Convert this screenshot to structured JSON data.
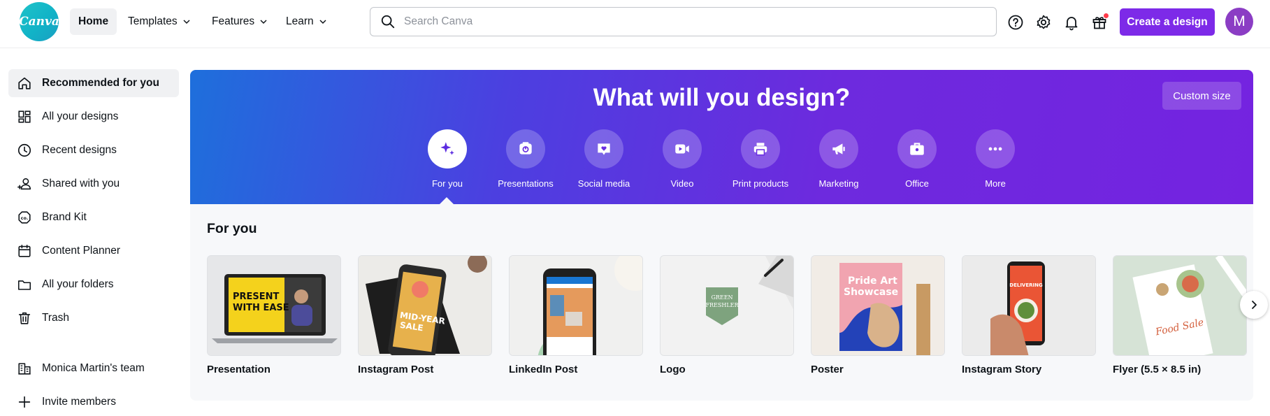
{
  "app": {
    "logo_text": "Canva"
  },
  "topnav": {
    "items": [
      {
        "label": "Home"
      },
      {
        "label": "Templates"
      },
      {
        "label": "Features"
      },
      {
        "label": "Learn"
      }
    ],
    "search_placeholder": "Search Canva",
    "create_label": "Create a design",
    "avatar_initial": "M"
  },
  "sidebar": {
    "items": [
      {
        "label": "Recommended for you",
        "icon": "home-icon"
      },
      {
        "label": "All your designs",
        "icon": "grid-icon"
      },
      {
        "label": "Recent designs",
        "icon": "clock-icon"
      },
      {
        "label": "Shared with you",
        "icon": "people-icon"
      },
      {
        "label": "Brand Kit",
        "icon": "brand-kit-icon"
      },
      {
        "label": "Content Planner",
        "icon": "calendar-icon"
      },
      {
        "label": "All your folders",
        "icon": "folder-icon"
      },
      {
        "label": "Trash",
        "icon": "trash-icon"
      }
    ],
    "team_label": "Monica Martin's team",
    "invite_label": "Invite members"
  },
  "hero": {
    "title": "What will you design?",
    "custom_size_label": "Custom size",
    "categories": [
      {
        "label": "For you",
        "icon": "sparkle-icon"
      },
      {
        "label": "Presentations",
        "icon": "presentation-icon"
      },
      {
        "label": "Social media",
        "icon": "heart-icon"
      },
      {
        "label": "Video",
        "icon": "video-icon"
      },
      {
        "label": "Print products",
        "icon": "printer-icon"
      },
      {
        "label": "Marketing",
        "icon": "megaphone-icon"
      },
      {
        "label": "Office",
        "icon": "briefcase-icon"
      },
      {
        "label": "More",
        "icon": "more-icon"
      }
    ]
  },
  "for_you": {
    "title": "For you",
    "tiles": [
      {
        "label": "Presentation",
        "thumb_text": "PRESENT WITH EASE"
      },
      {
        "label": "Instagram Post",
        "thumb_text": "MID-YEAR SALE"
      },
      {
        "label": "LinkedIn Post"
      },
      {
        "label": "Logo",
        "thumb_text": "GREEN FRESHLER"
      },
      {
        "label": "Poster",
        "thumb_text": "Pride Art Showcase"
      },
      {
        "label": "Instagram Story",
        "thumb_text": "DELIVERING"
      },
      {
        "label": "Flyer (5.5 × 8.5 in)",
        "thumb_text": "Food Sale"
      }
    ]
  },
  "colors": {
    "accent": "#7d2ae8",
    "logo": "#13b5c8"
  }
}
